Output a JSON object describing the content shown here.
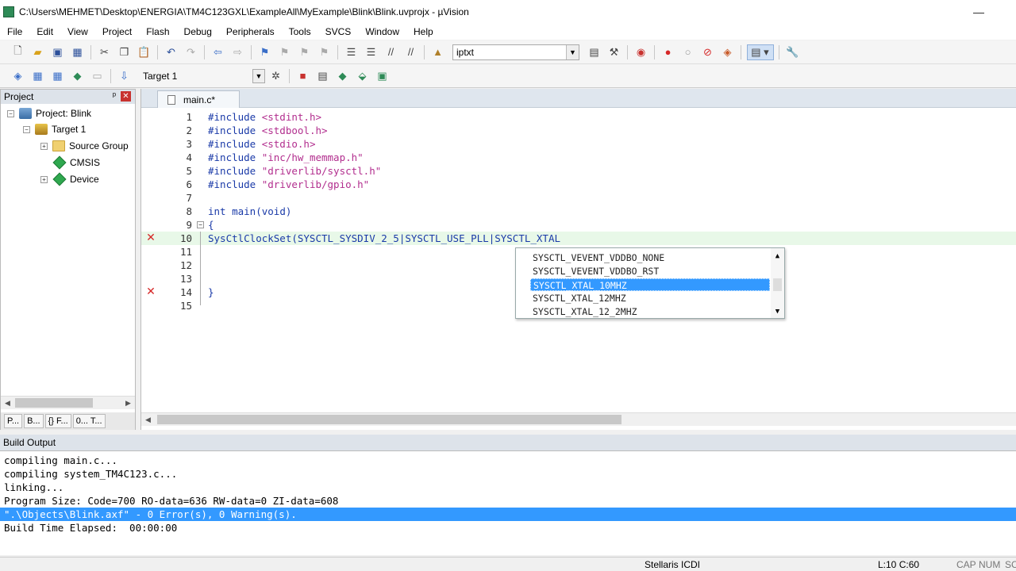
{
  "window": {
    "title": "C:\\Users\\MEHMET\\Desktop\\ENERGIA\\TM4C123GXL\\ExampleAll\\MyExample\\Blink\\Blink.uvprojx - µVision",
    "minimize": "—",
    "maximize": "☐"
  },
  "menu": [
    "File",
    "Edit",
    "View",
    "Project",
    "Flash",
    "Debug",
    "Peripherals",
    "Tools",
    "SVCS",
    "Window",
    "Help"
  ],
  "toolbar1": {
    "find_value": "iptxt"
  },
  "toolbar2": {
    "target_value": "Target 1"
  },
  "project_panel": {
    "title": "Project",
    "pin": "ᵖ",
    "close": "✕",
    "tree": [
      {
        "label": "Project: Blink",
        "expander": "−",
        "icon": "project-icon"
      },
      {
        "label": "Target 1",
        "expander": "−",
        "icon": "target-icon"
      },
      {
        "label": "Source Group",
        "expander": "+",
        "icon": "folder-icon"
      },
      {
        "label": "CMSIS",
        "expander": "",
        "icon": "component-icon"
      },
      {
        "label": "Device",
        "expander": "+",
        "icon": "component-icon"
      }
    ],
    "tabs": [
      "P...",
      "B...",
      "{} F...",
      "0... T..."
    ]
  },
  "editor": {
    "tab_label": "main.c*",
    "lines": [
      {
        "n": "1",
        "parts": [
          [
            "pp",
            "#include "
          ],
          [
            "str",
            "<stdint.h>"
          ]
        ]
      },
      {
        "n": "2",
        "parts": [
          [
            "pp",
            "#include "
          ],
          [
            "str",
            "<stdbool.h>"
          ]
        ]
      },
      {
        "n": "3",
        "parts": [
          [
            "pp",
            "#include "
          ],
          [
            "str",
            "<stdio.h>"
          ]
        ]
      },
      {
        "n": "4",
        "parts": [
          [
            "pp",
            "#include "
          ],
          [
            "str",
            "\"inc/hw_memmap.h\""
          ]
        ]
      },
      {
        "n": "5",
        "parts": [
          [
            "pp",
            "#include "
          ],
          [
            "str",
            "\"driverlib/sysctl.h\""
          ]
        ]
      },
      {
        "n": "6",
        "parts": [
          [
            "pp",
            "#include "
          ],
          [
            "str",
            "\"driverlib/gpio.h\""
          ]
        ]
      },
      {
        "n": "7",
        "parts": []
      },
      {
        "n": "8",
        "parts": [
          [
            "kw",
            "int "
          ],
          [
            "plain",
            "main("
          ],
          [
            "kw",
            "void"
          ],
          [
            "plain",
            ")"
          ]
        ]
      },
      {
        "n": "9",
        "parts": [
          [
            "plain",
            "{"
          ]
        ]
      },
      {
        "n": "10",
        "parts": [
          [
            "plain",
            "SysCtlClockSet(SYSCTL_SYSDIV_2_5|SYSCTL_USE_PLL|SYSCTL_XTAL"
          ]
        ]
      },
      {
        "n": "11",
        "parts": []
      },
      {
        "n": "12",
        "parts": []
      },
      {
        "n": "13",
        "parts": []
      },
      {
        "n": "14",
        "parts": [
          [
            "plain",
            "}"
          ]
        ]
      },
      {
        "n": "15",
        "parts": []
      }
    ],
    "error_mark": "✕",
    "fold_mark": "−"
  },
  "autocomplete": {
    "items": [
      "SYSCTL_VEVENT_VDDBO_NONE",
      "SYSCTL_VEVENT_VDDBO_RST",
      "SYSCTL_XTAL_10MHZ",
      "SYSCTL_XTAL_12MHZ",
      "SYSCTL_XTAL_12_2MHZ"
    ],
    "selected_index": 2
  },
  "build_output": {
    "title": "Build Output",
    "lines": [
      "compiling main.c...",
      "compiling system_TM4C123.c...",
      "linking...",
      "Program Size: Code=700 RO-data=636 RW-data=0 ZI-data=608",
      "\".\\Objects\\Blink.axf\" - 0 Error(s), 0 Warning(s).",
      "Build Time Elapsed:  00:00:00"
    ],
    "highlighted_index": 4
  },
  "status": {
    "debugger": "Stellaris ICDI",
    "position": "L:10 C:60",
    "caps": "CAP",
    "num": "NUM",
    "scrl": "SC"
  },
  "colors": {
    "selection": "#3399ff",
    "error": "#d62828",
    "keyword": "#1a3aa8",
    "string": "#b22e8e"
  }
}
